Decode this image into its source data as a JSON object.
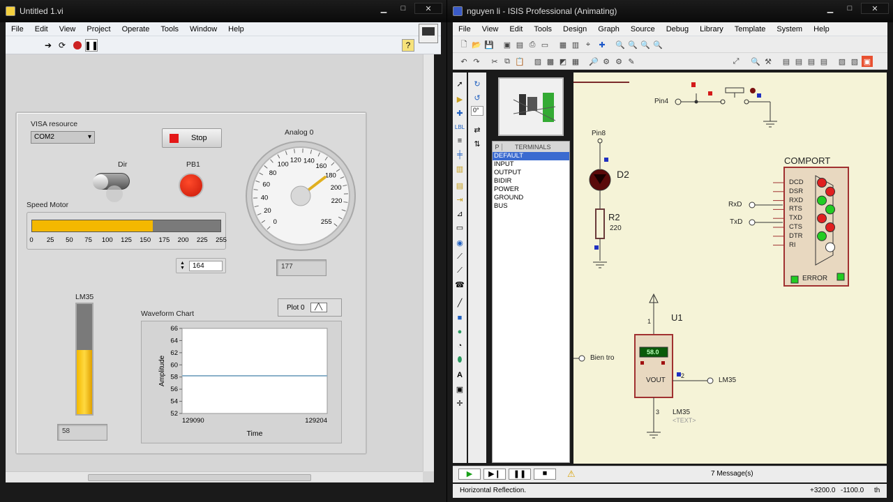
{
  "labview": {
    "title": "Untitled 1.vi",
    "menu": [
      "File",
      "Edit",
      "View",
      "Project",
      "Operate",
      "Tools",
      "Window",
      "Help"
    ],
    "controls": {
      "visa_label": "VISA resource",
      "visa_value": "COM2",
      "stop_label": "Stop",
      "dir_label": "Dir",
      "pb1_label": "PB1",
      "speed_label": "Speed Motor",
      "speed_ticks": [
        "0",
        "25",
        "50",
        "75",
        "100",
        "125",
        "150",
        "175",
        "200",
        "225",
        "255"
      ],
      "speed_value_fraction": 0.64,
      "speed_value": "164",
      "analog_label": "Analog 0",
      "analog_ticks": [
        "0",
        "20",
        "40",
        "60",
        "80",
        "100",
        "120",
        "140",
        "160",
        "180",
        "200",
        "220",
        "255"
      ],
      "analog_value": "177",
      "lm35_label": "LM35",
      "lm35_fill_fraction": 0.58,
      "lm35_value": "58",
      "plot_legend": "Plot 0",
      "chart_title": "Waveform Chart"
    }
  },
  "chart_data": {
    "type": "line",
    "title": "Waveform Chart",
    "xlabel": "Time",
    "ylabel": "Amplitude",
    "xlim": [
      129090,
      129204
    ],
    "ylim": [
      52,
      66
    ],
    "y_ticks": [
      "66",
      "64",
      "62",
      "60",
      "58",
      "56",
      "54",
      "52"
    ],
    "x_ticks": [
      "129090",
      "129204"
    ],
    "series": [
      {
        "name": "Plot 0",
        "x": [
          129090,
          129204
        ],
        "values": [
          58.2,
          58.2
        ]
      }
    ],
    "colors": {
      "line": "#8ab0c8"
    }
  },
  "proteus": {
    "title": "nguyen li - ISIS Professional (Animating)",
    "menu": [
      "File",
      "View",
      "Edit",
      "Tools",
      "Design",
      "Graph",
      "Source",
      "Debug",
      "Library",
      "Template",
      "System",
      "Help"
    ],
    "device_panel": {
      "p_btn": "P",
      "header": "TERMINALS",
      "items": [
        "DEFAULT",
        "INPUT",
        "OUTPUT",
        "BIDIR",
        "POWER",
        "GROUND",
        "BUS"
      ]
    },
    "rotation_value": "0°",
    "schematic": {
      "pin4": "Pin4",
      "pin8": "Pin8",
      "d2": "D2",
      "r2": "R2",
      "r2_val": "220",
      "comport": "COMPORT",
      "com_pins": [
        "DCD",
        "DSR",
        "RXD",
        "RTS",
        "TXD",
        "CTS",
        "DTR",
        "RI"
      ],
      "rxd": "RxD",
      "txd": "TxD",
      "error": "ERROR",
      "u1": "U1",
      "lcd": "58.0",
      "vout": "VOUT",
      "pin1": "1",
      "pin2": "2",
      "pin3": "3",
      "lm35_net": "LM35",
      "lm35_part": "LM35",
      "text_ph": "<TEXT>",
      "bientro": "Bien tro"
    },
    "messages": "7 Message(s)",
    "status": "Horizontal Reflection.",
    "coords": [
      "+3200.0",
      "-1100.0",
      "th"
    ]
  },
  "colors": {
    "red": "#e41818",
    "gauge_needle": "#e0b020",
    "fill": "#f4b800",
    "led_green": "#22cc22",
    "schematic_bg": "#f5f3d7",
    "wire_dark": "#5a2a2a"
  }
}
